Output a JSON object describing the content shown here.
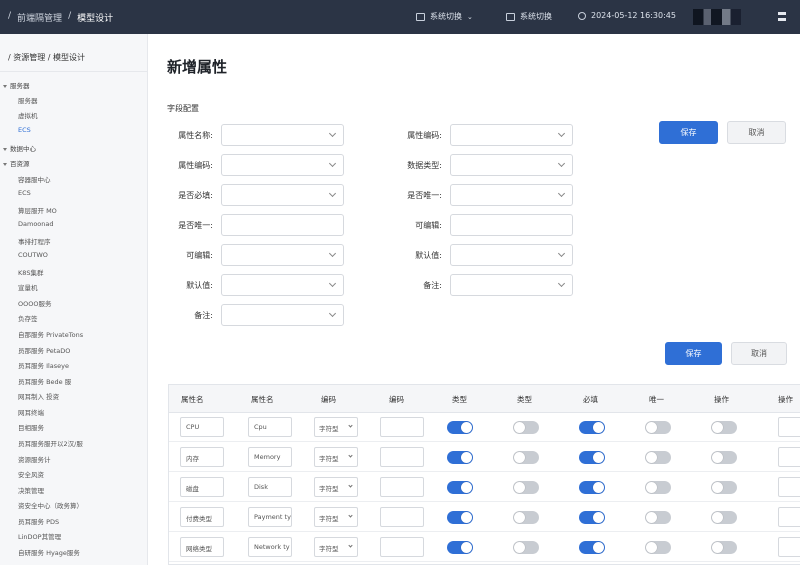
{
  "topbar": {
    "crumb_1": "前端隔管理",
    "crumb_sep": "/",
    "crumb_2": "模型设计",
    "switch_1": "系统切换",
    "switch_2": "系统切换",
    "datetime": "2024-05-12 16:30:45"
  },
  "sidebar": {
    "title": "/ 资源管理 / 模型设计",
    "items": [
      {
        "label": "服务器",
        "type": "group"
      },
      {
        "label": "服务器",
        "type": "child"
      },
      {
        "label": "虚拟机",
        "type": "child"
      },
      {
        "label": "ECS",
        "type": "active"
      },
      {
        "label": "数据中心",
        "type": "group"
      },
      {
        "label": "百资源",
        "type": "group"
      },
      {
        "label": "容器服中心",
        "type": "child"
      },
      {
        "label": "ECS",
        "type": "child"
      },
      {
        "label": "算层服开 MO",
        "type": "child"
      },
      {
        "label": "Damoonad",
        "type": "child"
      },
      {
        "label": "事排打程序",
        "type": "child"
      },
      {
        "label": "COUTWO",
        "type": "child"
      },
      {
        "label": "K8S集群",
        "type": "child"
      },
      {
        "label": "宣量机",
        "type": "child"
      },
      {
        "label": "OOOO服务",
        "type": "child"
      },
      {
        "label": "负存签",
        "type": "child"
      },
      {
        "label": "自那服务 PrivateTons",
        "type": "child"
      },
      {
        "label": "员那服务 PetaDO",
        "type": "child"
      },
      {
        "label": "员耳服务 Ilaseye",
        "type": "child"
      },
      {
        "label": "员耳服务 Bede 服",
        "type": "child"
      },
      {
        "label": "网耳制入 投资",
        "type": "child"
      },
      {
        "label": "网耳终端",
        "type": "child"
      },
      {
        "label": "目相服务",
        "type": "child"
      },
      {
        "label": "员耳服务服开以2汉/服",
        "type": "child"
      },
      {
        "label": "资源服务计",
        "type": "child"
      },
      {
        "label": "安全风资",
        "type": "child"
      },
      {
        "label": "决策管理",
        "type": "child"
      },
      {
        "label": "资安全中心（政务算）",
        "type": "child"
      },
      {
        "label": "员耳服务 PDS",
        "type": "child"
      },
      {
        "label": "LinDOP其管理",
        "type": "child"
      },
      {
        "label": "自研服务 Hyage服务",
        "type": "child"
      }
    ]
  },
  "main": {
    "title": "新增属性",
    "section_label": "字段配置",
    "form_left": [
      {
        "label": "属性名称:",
        "kind": "select"
      },
      {
        "label": "属性编码:",
        "kind": "select"
      },
      {
        "label": "是否必填:",
        "kind": "select"
      },
      {
        "label": "是否唯一:",
        "kind": "input"
      },
      {
        "label": "可编辑:",
        "kind": "select"
      },
      {
        "label": "默认值:",
        "kind": "select"
      },
      {
        "label": "备注:",
        "kind": "select"
      }
    ],
    "form_right": [
      {
        "label": "属性编码:",
        "kind": "select"
      },
      {
        "label": "数据类型:",
        "kind": "select"
      },
      {
        "label": "是否唯一:",
        "kind": "select"
      },
      {
        "label": "可编辑:",
        "kind": "input"
      },
      {
        "label": "默认值:",
        "kind": "select"
      },
      {
        "label": "备注:",
        "kind": "select"
      }
    ],
    "save_label": "保存",
    "cancel_label": "取消",
    "save_label_2": "保存",
    "cancel_label_2": "取消"
  },
  "table": {
    "headers": [
      "属性名",
      "属性名",
      "编码",
      "编码",
      "类型",
      "类型",
      "必填",
      "唯一",
      "操作",
      "操作"
    ],
    "rows": [
      {
        "name": "CPU",
        "code": "Cpu",
        "type": "字符型",
        "t1": true,
        "t2": false,
        "req": true,
        "uni": false,
        "op": false
      },
      {
        "name": "内存",
        "code": "Memory",
        "type": "字符型",
        "t1": true,
        "t2": false,
        "req": true,
        "uni": false,
        "op": false
      },
      {
        "name": "磁盘",
        "code": "Disk",
        "type": "字符型",
        "t1": true,
        "t2": false,
        "req": true,
        "uni": false,
        "op": false
      },
      {
        "name": "付费类型",
        "code": "Payment ty",
        "type": "字符型",
        "t1": true,
        "t2": false,
        "req": true,
        "uni": false,
        "op": false
      },
      {
        "name": "网络类型",
        "code": "Network ty",
        "type": "字符型",
        "t1": true,
        "t2": false,
        "req": true,
        "uni": false,
        "op": false
      }
    ]
  },
  "colors": {
    "accent": "#2f6fd6",
    "topbar": "#2b3445",
    "toggle_off": "#c8ccd2"
  }
}
